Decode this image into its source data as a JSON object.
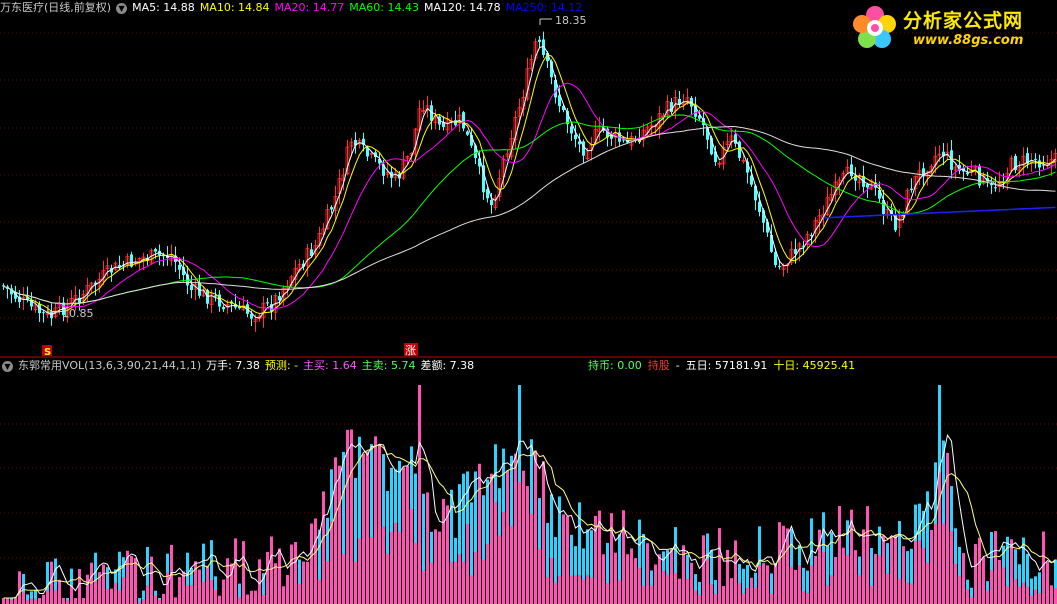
{
  "header": {
    "stock_title": "万东医疗(日线,前复权)",
    "ma": [
      {
        "label": "MA5: 14.88",
        "color": "#ffffff"
      },
      {
        "label": "MA10: 14.84",
        "color": "#ffff00"
      },
      {
        "label": "MA20: 14.77",
        "color": "#ff00ff"
      },
      {
        "label": "MA60: 14.43",
        "color": "#00ff00"
      },
      {
        "label": "MA120: 14.78",
        "color": "#ffffff"
      },
      {
        "label": "MA250: 14.12",
        "color": "#0000ff"
      }
    ]
  },
  "price_annotations": {
    "high": "18.35",
    "low": "10.85",
    "buy_marker": "S",
    "rise_marker": "涨"
  },
  "volume_header": {
    "indicator": "东郭常用VOL(13,6,3,90,21,44,1,1)",
    "wanshou": "万手: 7.38",
    "yuce_label": "预测: -",
    "zhumai": "主买: 1.64",
    "zhumai2": "主卖: 5.74",
    "chae": "差额: 7.38",
    "chibi": "持币: 0.00",
    "chigu": "持股",
    "dash": "-",
    "wuri": "五日: 57181.91",
    "shiri": "十日: 45925.41"
  },
  "logo": {
    "name": "分析家公式网",
    "url": "www.88gs.com"
  },
  "colors": {
    "up": "#ff3232",
    "down": "#54ffff",
    "volume_up": "#ff54b4",
    "volume_down": "#2fd2ff",
    "divider": "#c00000",
    "grid": "#7a0000"
  }
}
